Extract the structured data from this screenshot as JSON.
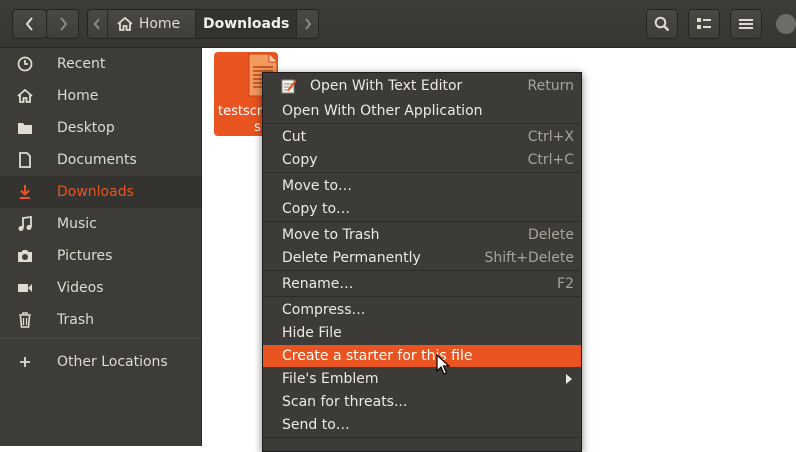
{
  "header": {
    "back_icon": "chevron-left-icon",
    "forward_icon": "chevron-right-icon",
    "path_left_icon": "chevron-left-icon",
    "path": [
      {
        "label": "Home",
        "icon": "home-icon"
      },
      {
        "label": "Downloads"
      }
    ],
    "path_right_icon": "chevron-right-icon",
    "search_icon": "search-icon",
    "view_icon": "list-view-icon",
    "menu_icon": "hamburger-menu-icon"
  },
  "sidebar": {
    "items": [
      {
        "label": "Recent",
        "icon": "clock-icon"
      },
      {
        "label": "Home",
        "icon": "home-icon"
      },
      {
        "label": "Desktop",
        "icon": "folder-icon"
      },
      {
        "label": "Documents",
        "icon": "document-icon"
      },
      {
        "label": "Downloads",
        "icon": "download-icon",
        "active": true
      },
      {
        "label": "Music",
        "icon": "music-icon"
      },
      {
        "label": "Pictures",
        "icon": "camera-icon"
      },
      {
        "label": "Videos",
        "icon": "video-icon"
      },
      {
        "label": "Trash",
        "icon": "trash-icon"
      },
      {
        "label": "Other Locations",
        "icon": "plus-icon"
      }
    ]
  },
  "file": {
    "name_line1": "testscr",
    "name_line2": "sh",
    "icon": "text-file-icon"
  },
  "context_menu": {
    "items": [
      {
        "label": "Open With Text Editor",
        "shortcut": "Return",
        "icon": "text-editor-icon"
      },
      {
        "label": "Open With Other Application",
        "shortcut": ""
      },
      {
        "label": "Cut",
        "shortcut": "Ctrl+X"
      },
      {
        "label": "Copy",
        "shortcut": "Ctrl+C"
      },
      {
        "label": "Move to…",
        "shortcut": ""
      },
      {
        "label": "Copy to…",
        "shortcut": ""
      },
      {
        "label": "Move to Trash",
        "shortcut": "Delete"
      },
      {
        "label": "Delete Permanently",
        "shortcut": "Shift+Delete"
      },
      {
        "label": "Rename…",
        "shortcut": "F2"
      },
      {
        "label": "Compress…",
        "shortcut": ""
      },
      {
        "label": "Hide File",
        "shortcut": ""
      },
      {
        "label": "Create a starter for this file",
        "shortcut": "",
        "highlighted": true
      },
      {
        "label": "File's Emblem",
        "shortcut": "",
        "submenu": true
      },
      {
        "label": "Scan for threats...",
        "shortcut": ""
      },
      {
        "label": "Send to…",
        "shortcut": ""
      }
    ]
  },
  "colors": {
    "accent": "#e95420",
    "header_bg": "#3c3a37",
    "sidebar_bg": "#3e3c39",
    "menu_bg": "#3c3b37"
  }
}
